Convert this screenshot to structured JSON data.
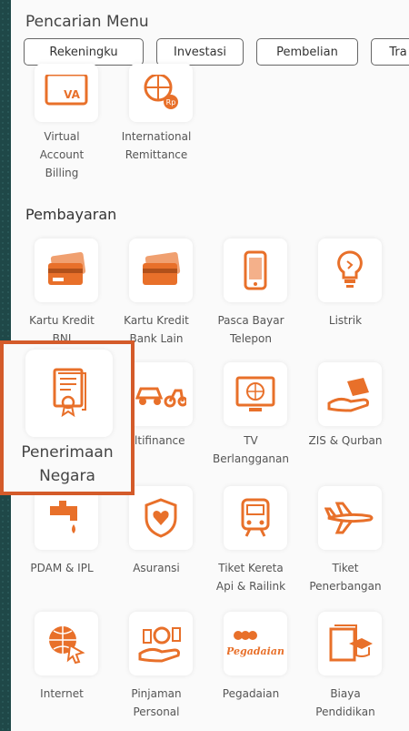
{
  "header": {
    "title": "Pencarian Menu"
  },
  "chips": [
    "Rekeningku",
    "Investasi",
    "Pembelian",
    "Tra"
  ],
  "accent_color": "#e8702a",
  "highlight_color": "#d45b2a",
  "top_items": [
    {
      "icon": "va-card-icon",
      "badge": "VA",
      "label": [
        "Virtual",
        "Account",
        "Billing"
      ]
    },
    {
      "icon": "globe-money-icon",
      "label": [
        "International",
        "Remittance"
      ]
    }
  ],
  "pembayaran": {
    "title": "Pembayaran",
    "items": [
      {
        "icon": "credit-card-icon",
        "label": [
          "Kartu Kredit",
          "BNI"
        ]
      },
      {
        "icon": "credit-card-icon",
        "label": [
          "Kartu Kredit",
          "Bank Lain"
        ]
      },
      {
        "icon": "phone-icon",
        "label": [
          "Pasca Bayar",
          "Telepon"
        ]
      },
      {
        "icon": "lightbulb-icon",
        "label": [
          "Listrik"
        ]
      },
      {
        "icon": "certificate-icon",
        "label": [
          "Penerimaan",
          "Negara"
        ]
      },
      {
        "icon": "vehicle-icon",
        "label": [
          "Multifinance"
        ],
        "visible_label": "ultifinance"
      },
      {
        "icon": "tv-icon",
        "label": [
          "TV",
          "Berlangganan"
        ]
      },
      {
        "icon": "hand-heart-icon",
        "label": [
          "ZIS & Qurban"
        ]
      },
      {
        "icon": "faucet-icon",
        "label": [
          "PDAM & IPL"
        ]
      },
      {
        "icon": "shield-heart-icon",
        "label": [
          "Asuransi"
        ]
      },
      {
        "icon": "train-icon",
        "label": [
          "Tiket Kereta",
          "Api & Railink"
        ]
      },
      {
        "icon": "airplane-icon",
        "label": [
          "Tiket",
          "Penerbangan"
        ]
      },
      {
        "icon": "globe-cursor-icon",
        "label": [
          "Internet"
        ]
      },
      {
        "icon": "hand-coins-icon",
        "label": [
          "Pinjaman",
          "Personal"
        ]
      },
      {
        "icon": "pegadaian-logo-icon",
        "badge": "Pegadaian",
        "label": [
          "Pegadaian"
        ]
      },
      {
        "icon": "graduation-book-icon",
        "label": [
          "Biaya",
          "Pendidikan"
        ]
      }
    ]
  }
}
